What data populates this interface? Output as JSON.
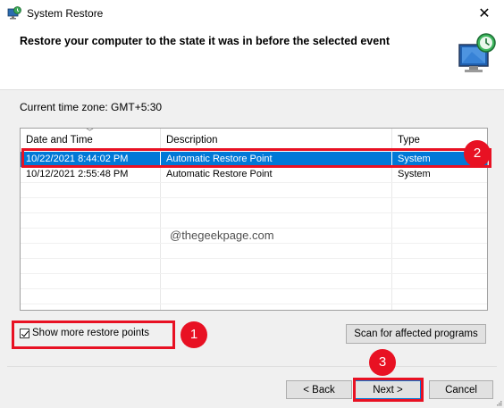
{
  "window": {
    "title": "System Restore",
    "close_glyph": "✕"
  },
  "header": {
    "heading": "Restore your computer to the state it was in before the selected event",
    "icon": "system-restore-icon"
  },
  "timezone_label": "Current time zone: GMT+5:30",
  "table": {
    "columns": [
      "Date and Time",
      "Description",
      "Type"
    ],
    "rows": [
      {
        "date": "10/22/2021 8:44:02 PM",
        "description": "Automatic Restore Point",
        "type": "System",
        "selected": true
      },
      {
        "date": "10/12/2021 2:55:48 PM",
        "description": "Automatic Restore Point",
        "type": "System",
        "selected": false
      }
    ]
  },
  "watermark": "@thegeekpage.com",
  "show_more_label": "Show more restore points",
  "show_more_checked": true,
  "buttons": {
    "scan": "Scan for affected programs",
    "back": "< Back",
    "next": "Next >",
    "cancel": "Cancel"
  },
  "badges": [
    "1",
    "2",
    "3"
  ],
  "colors": {
    "selection": "#0078d7",
    "highlight": "#e81123"
  }
}
